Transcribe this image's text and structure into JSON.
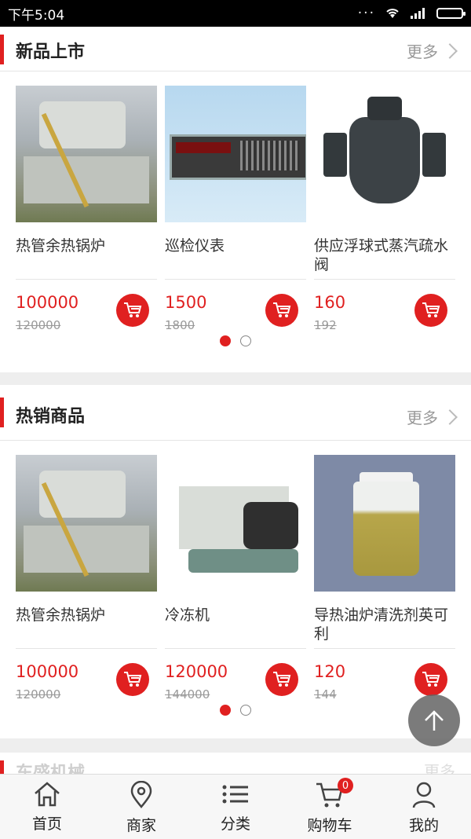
{
  "status_bar": {
    "time": "下午5:04"
  },
  "sections": [
    {
      "title": "新品上市",
      "more_label": "更多",
      "products": [
        {
          "name": "热管余热锅炉",
          "price": "100000",
          "old_price": "120000"
        },
        {
          "name": "巡检仪表",
          "price": "1500",
          "old_price": "1800"
        },
        {
          "name": "供应浮球式蒸汽疏水阀",
          "price": "160",
          "old_price": "192"
        }
      ]
    },
    {
      "title": "热销商品",
      "more_label": "更多",
      "products": [
        {
          "name": "热管余热锅炉",
          "price": "100000",
          "old_price": "120000"
        },
        {
          "name": "冷冻机",
          "price": "120000",
          "old_price": "144000"
        },
        {
          "name": "导热油炉清洗剂英可利",
          "price": "120",
          "old_price": "144"
        }
      ]
    },
    {
      "title": "东盛机械",
      "more_label": "更多"
    }
  ],
  "bottom_nav": {
    "items": [
      {
        "label": "首页",
        "icon": "home-icon"
      },
      {
        "label": "商家",
        "icon": "location-pin-icon"
      },
      {
        "label": "分类",
        "icon": "list-icon"
      },
      {
        "label": "购物车",
        "icon": "cart-icon",
        "badge": "0"
      },
      {
        "label": "我的",
        "icon": "user-icon"
      }
    ]
  },
  "colors": {
    "accent": "#e02020"
  }
}
